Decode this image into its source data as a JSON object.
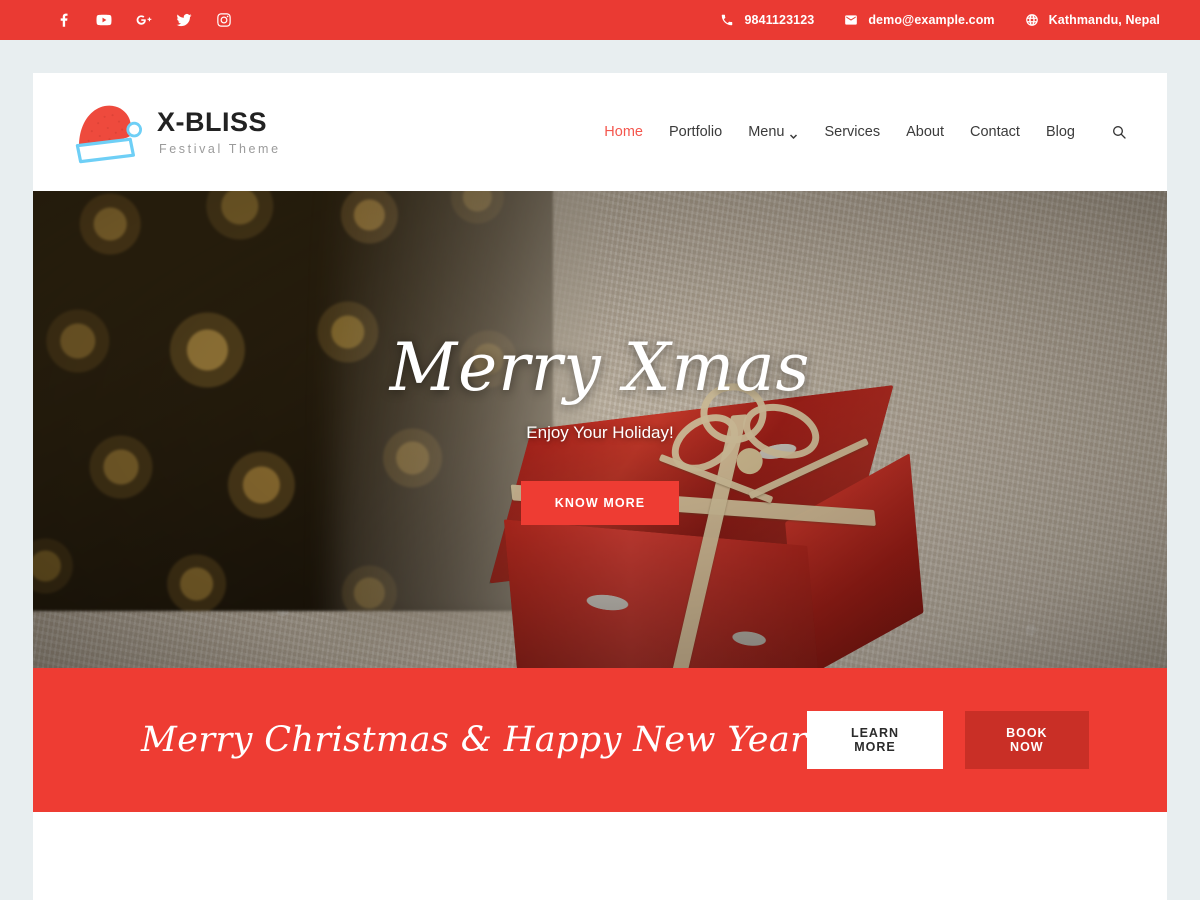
{
  "topbar": {
    "social": [
      {
        "name": "facebook-icon",
        "label": "Facebook"
      },
      {
        "name": "youtube-icon",
        "label": "YouTube"
      },
      {
        "name": "google-plus-icon",
        "label": "Google Plus"
      },
      {
        "name": "twitter-icon",
        "label": "Twitter"
      },
      {
        "name": "instagram-icon",
        "label": "Instagram"
      }
    ],
    "phone": "9841123123",
    "email": "demo@example.com",
    "location": "Kathmandu, Nepal"
  },
  "brand": {
    "name": "X-BLISS",
    "tagline": "Festival Theme",
    "logo_icon": "santa-hat-icon"
  },
  "nav": {
    "items": [
      {
        "label": "Home",
        "active": true,
        "has_dropdown": false
      },
      {
        "label": "Portfolio",
        "active": false,
        "has_dropdown": false
      },
      {
        "label": "Menu",
        "active": false,
        "has_dropdown": true
      },
      {
        "label": "Services",
        "active": false,
        "has_dropdown": false
      },
      {
        "label": "About",
        "active": false,
        "has_dropdown": false
      },
      {
        "label": "Contact",
        "active": false,
        "has_dropdown": false
      },
      {
        "label": "Blog",
        "active": false,
        "has_dropdown": false
      }
    ],
    "search_icon": "search-icon"
  },
  "hero": {
    "title": "Merry Xmas",
    "subtitle": "Enjoy Your Holiday!",
    "button": "KNOW MORE",
    "image_alt": "Red Christmas gift box with raffia bow on cream carpet beside golden pine cones"
  },
  "cta": {
    "heading": "Merry Christmas & Happy New Year",
    "learn_more": "LEARN MORE",
    "book_now": "BOOK NOW"
  },
  "colors": {
    "brand_red": "#ee3c33",
    "topbar_red": "#ea3a33",
    "book_now_red": "#c92f26",
    "nav_active": "#f4574e",
    "page_bg": "#e8eef0",
    "hat_trim_blue": "#6ecff6"
  }
}
